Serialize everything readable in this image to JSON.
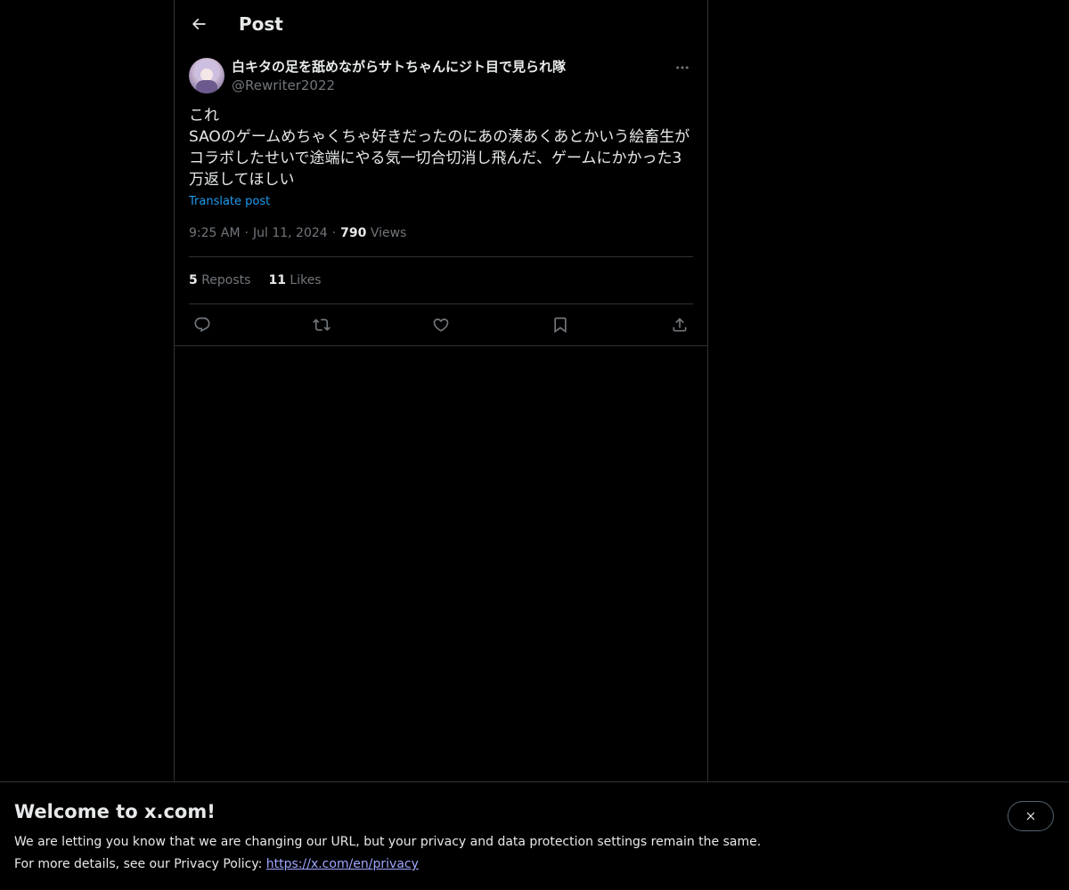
{
  "header": {
    "title": "Post"
  },
  "post": {
    "author": {
      "display_name": "白キタの足を舐めながらサトちゃんにジト目で見られ隊",
      "handle": "@Rewriter2022"
    },
    "text_lines": [
      "これ",
      "SAOのゲームめちゃくちゃ好きだったのにあの湊あくあとかいう絵畜生が",
      "コラボしたせいで途端にやる気一切合切消し飛んだ、ゲームにかかった3",
      "万返してほしい"
    ],
    "translate_label": "Translate post",
    "time": "9:25 AM",
    "date": "Jul 11, 2024",
    "separator": "·",
    "views_count": "790",
    "views_label": "Views",
    "reposts_count": "5",
    "reposts_label": "Reposts",
    "likes_count": "11",
    "likes_label": "Likes",
    "actions": [
      "reply-icon",
      "repost-icon",
      "like-icon",
      "bookmark-icon",
      "share-icon"
    ]
  },
  "banner": {
    "title": "Welcome to x.com!",
    "line1": "We are letting you know that we are changing our URL, but your privacy and data protection settings remain the same.",
    "line2_prefix": "For more details, see our Privacy Policy: ",
    "privacy_link": "https://x.com/en/privacy"
  },
  "colors": {
    "background": "#000000",
    "text_primary": "#e7e9ea",
    "text_secondary": "#71767b",
    "accent": "#1d9bf0",
    "border": "#2f3336",
    "link_visited": "#9fa6ff"
  }
}
